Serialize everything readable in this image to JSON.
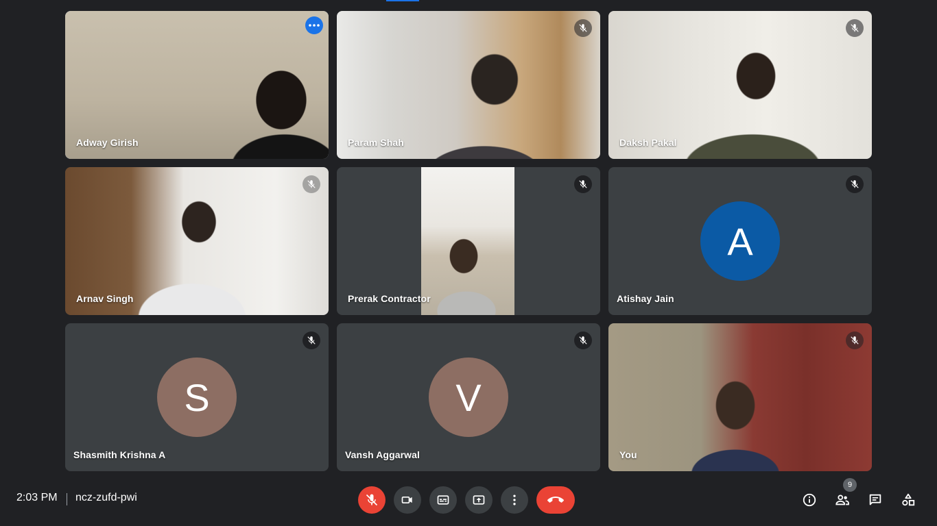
{
  "participants": [
    {
      "name": "Adway Girish",
      "initial": "",
      "active": true
    },
    {
      "name": "Param Shah",
      "initial": ""
    },
    {
      "name": "Daksh Pakal",
      "initial": ""
    },
    {
      "name": "Arnav Singh",
      "initial": ""
    },
    {
      "name": "Prerak Contractor",
      "initial": ""
    },
    {
      "name": "Atishay Jain",
      "initial": "A",
      "avatar_color": "#0b5aa5"
    },
    {
      "name": "Shasmith Krishna A",
      "initial": "S",
      "avatar_color": "#8d6e63"
    },
    {
      "name": "Vansh Aggarwal",
      "initial": "V",
      "avatar_color": "#8d6e63"
    },
    {
      "name": "You",
      "initial": ""
    }
  ],
  "footer": {
    "time": "2:03 PM",
    "meeting_code": "ncz-zufd-pwi",
    "participant_count": "9"
  },
  "controls": [
    "mic-off-icon",
    "camera-icon",
    "captions-icon",
    "present-icon",
    "more-options-icon",
    "hang-up-icon"
  ],
  "right_icons": [
    "info-icon",
    "people-icon",
    "chat-icon",
    "activities-icon"
  ],
  "colors": {
    "background": "#202124",
    "tile": "#3c4043",
    "accent": "#1a73e8",
    "danger": "#ea4335"
  }
}
